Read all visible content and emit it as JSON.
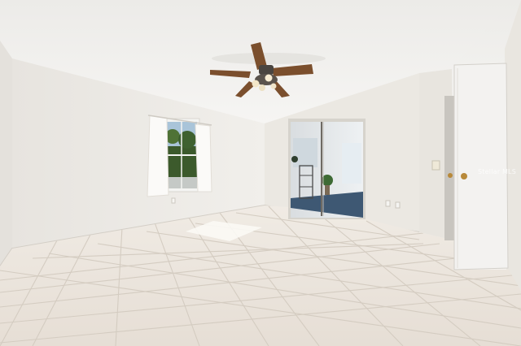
{
  "photo": {
    "watermark": "Stellar MLS",
    "colors": {
      "ceiling": "#f1f0ee",
      "wall_left": "#efede9",
      "wall_back": "#ebe8e2",
      "wall_right": "#e9e6e0",
      "floor_tile": "#ebe5de",
      "grout": "#d6cec4",
      "fan_blade": "#7b4f2d",
      "door": "#f2f0ee",
      "carpet": "#3e5873"
    }
  }
}
